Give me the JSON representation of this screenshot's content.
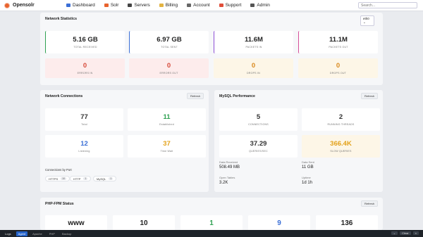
{
  "topbar": {
    "brand": "Opensolr",
    "nav": [
      {
        "label": "Dashboard",
        "icon": "dashboard-icon",
        "color": "#3b6fd6"
      },
      {
        "label": "Solr",
        "icon": "solr-icon",
        "color": "#e8632e"
      },
      {
        "label": "Servers",
        "icon": "server-icon",
        "color": "#444444"
      },
      {
        "label": "Billing",
        "icon": "billing-icon",
        "color": "#e3b341"
      },
      {
        "label": "Account",
        "icon": "account-icon",
        "color": "#666666"
      },
      {
        "label": "Support",
        "icon": "support-icon",
        "color": "#e04e39"
      },
      {
        "label": "Admin",
        "icon": "admin-icon",
        "color": "#555555"
      }
    ],
    "search_placeholder": "Search..."
  },
  "network": {
    "title": "Network Statistics",
    "interface": "eth0",
    "cards": [
      {
        "value": "5.16 GB",
        "label": "TOTAL RECEIVED",
        "color": "#2fa152"
      },
      {
        "value": "6.97 GB",
        "label": "TOTAL SENT",
        "color": "#3b6fd6"
      },
      {
        "value": "11.6M",
        "label": "PACKETS IN",
        "color": "#8e4fd6"
      },
      {
        "value": "11.1M",
        "label": "PACKETS OUT",
        "color": "#d64f9a"
      }
    ],
    "errors": [
      {
        "value": "0",
        "label": "ERRORS IN",
        "color": "#d64b3b",
        "bg": "#fdecec"
      },
      {
        "value": "0",
        "label": "ERRORS OUT",
        "color": "#d64b3b",
        "bg": "#fdecec"
      },
      {
        "value": "0",
        "label": "DROPS IN",
        "color": "#d98a1f",
        "bg": "#fdf6e7"
      },
      {
        "value": "0",
        "label": "DROPS OUT",
        "color": "#d98a1f",
        "bg": "#fdf6e7"
      }
    ]
  },
  "connections": {
    "title": "Network Connections",
    "refresh": "Refresh",
    "cards": [
      {
        "value": "77",
        "label": "Total",
        "color": "#333333"
      },
      {
        "value": "11",
        "label": "Established",
        "color": "#2fa152"
      },
      {
        "value": "12",
        "label": "Listening",
        "color": "#3b6fd6"
      },
      {
        "value": "37",
        "label": "Time Wait",
        "color": "#e3a21b"
      }
    ],
    "ports_label": "Connections by Port",
    "ports": [
      {
        "name": "HTTPS",
        "count": "10"
      },
      {
        "name": "HTTP",
        "count": "1"
      },
      {
        "name": "MySQL",
        "count": "1"
      }
    ]
  },
  "mysql": {
    "title": "MySQL Performance",
    "refresh": "Refresh",
    "cards": [
      {
        "value": "5",
        "label": "CONNECTIONS",
        "color": "#333333"
      },
      {
        "value": "2",
        "label": "RUNNING THREADS",
        "color": "#333333"
      },
      {
        "value": "37.29",
        "label": "QUERIES/SEC",
        "color": "#333333"
      },
      {
        "value": "366.4K",
        "label": "SLOW QUERIES",
        "color": "#e3a21b"
      }
    ],
    "stats": [
      {
        "key": "Data Received",
        "value": "508.49 MB"
      },
      {
        "key": "Data Sent",
        "value": "11 GB"
      },
      {
        "key": "Open Tables",
        "value": "3.2K"
      },
      {
        "key": "Uptime",
        "value": "1d 1h"
      }
    ]
  },
  "fpm": {
    "title": "PHP-FPM Status",
    "refresh": "Refresh",
    "cards": [
      {
        "value": "www",
        "color": "#222222"
      },
      {
        "value": "10",
        "color": "#222222"
      },
      {
        "value": "1",
        "color": "#2fa152"
      },
      {
        "value": "9",
        "color": "#3b6fd6"
      },
      {
        "value": "136",
        "color": "#222222"
      }
    ]
  },
  "bottombar": {
    "tabs": [
      "Logs",
      "Agent",
      "Apache",
      "PHP",
      "Backup"
    ],
    "active_tab": "Agent",
    "buttons": [
      "Clear"
    ]
  }
}
